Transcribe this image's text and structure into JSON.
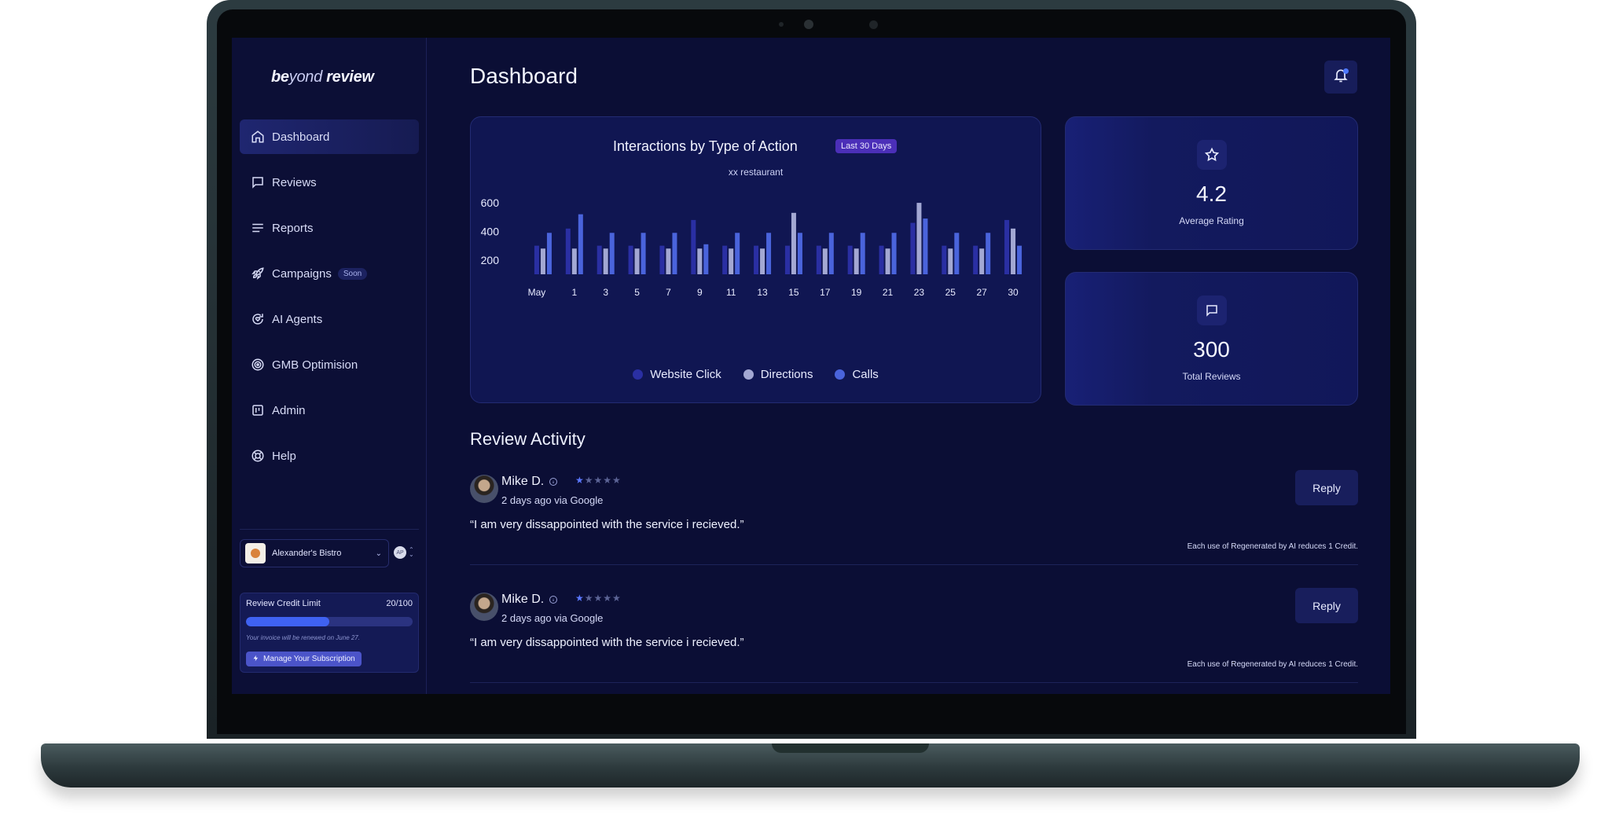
{
  "app": {
    "logo_bold_1": "be",
    "logo_light": "yond",
    "logo_bold_2": " review"
  },
  "sidebar": {
    "items": [
      {
        "label": "Dashboard",
        "icon": "home-icon"
      },
      {
        "label": "Reviews",
        "icon": "message-square-icon"
      },
      {
        "label": "Reports",
        "icon": "lines-icon"
      },
      {
        "label": "Campaigns",
        "icon": "rocket-icon",
        "badge": "Soon"
      },
      {
        "label": "AI Agents",
        "icon": "refresh-heart-icon"
      },
      {
        "label": "GMB Optimision",
        "icon": "target-icon"
      },
      {
        "label": "Admin",
        "icon": "kanban-icon"
      },
      {
        "label": "Help",
        "icon": "lifebuoy-icon"
      }
    ],
    "business": {
      "name": "Alexander's Bistro"
    },
    "user_initials": "AP",
    "credit": {
      "label": "Review Credit Limit",
      "count": "20/100",
      "used_fraction": 0.5,
      "note": "Your invoice will be renewed on June 27.",
      "manage_label": "Manage Your Subscription"
    }
  },
  "header": {
    "title": "Dashboard"
  },
  "chart_card": {
    "title": "Interactions by Type of Action",
    "badge": "Last 30 Days",
    "subtitle": "xx restaurant"
  },
  "chart_data": {
    "type": "bar",
    "categories": [
      "May",
      "1",
      "3",
      "5",
      "7",
      "9",
      "11",
      "13",
      "15",
      "17",
      "19",
      "21",
      "23",
      "25",
      "27",
      "30"
    ],
    "ylim": [
      100,
      650
    ],
    "yticks": [
      200,
      400,
      600
    ],
    "legend_position": "bottom",
    "series": [
      {
        "name": "Website Click",
        "color": "#2a2fa3",
        "values": [
          300,
          420,
          300,
          300,
          300,
          480,
          300,
          300,
          300,
          300,
          300,
          300,
          460,
          300,
          300,
          480
        ]
      },
      {
        "name": "Directions",
        "color": "#a3a8d3",
        "values": [
          280,
          280,
          280,
          280,
          280,
          280,
          280,
          280,
          530,
          280,
          280,
          280,
          600,
          280,
          280,
          420
        ]
      },
      {
        "name": "Calls",
        "color": "#4a64dc",
        "values": [
          390,
          520,
          390,
          390,
          390,
          310,
          390,
          390,
          390,
          390,
          390,
          390,
          490,
          390,
          390,
          300
        ]
      }
    ]
  },
  "stats": [
    {
      "icon": "star-icon",
      "value": "4.2",
      "label": "Average Rating"
    },
    {
      "icon": "message-square-icon",
      "value": "300",
      "label": "Total Reviews"
    }
  ],
  "review_section": {
    "title": "Review Activity"
  },
  "reviews": [
    {
      "name": "Mike D.",
      "rating": 1,
      "meta": "2 days ago via Google",
      "text": "“I am very dissappointed with the service i recieved.”",
      "reply_label": "Reply",
      "credit_note": "Each use of Regenerated by AI reduces 1 Credit."
    },
    {
      "name": "Mike D.",
      "rating": 1,
      "meta": "2 days ago via Google",
      "text": "“I am very dissappointed with the service i recieved.”",
      "reply_label": "Reply",
      "credit_note": "Each use of Regenerated by AI reduces 1 Credit."
    }
  ]
}
